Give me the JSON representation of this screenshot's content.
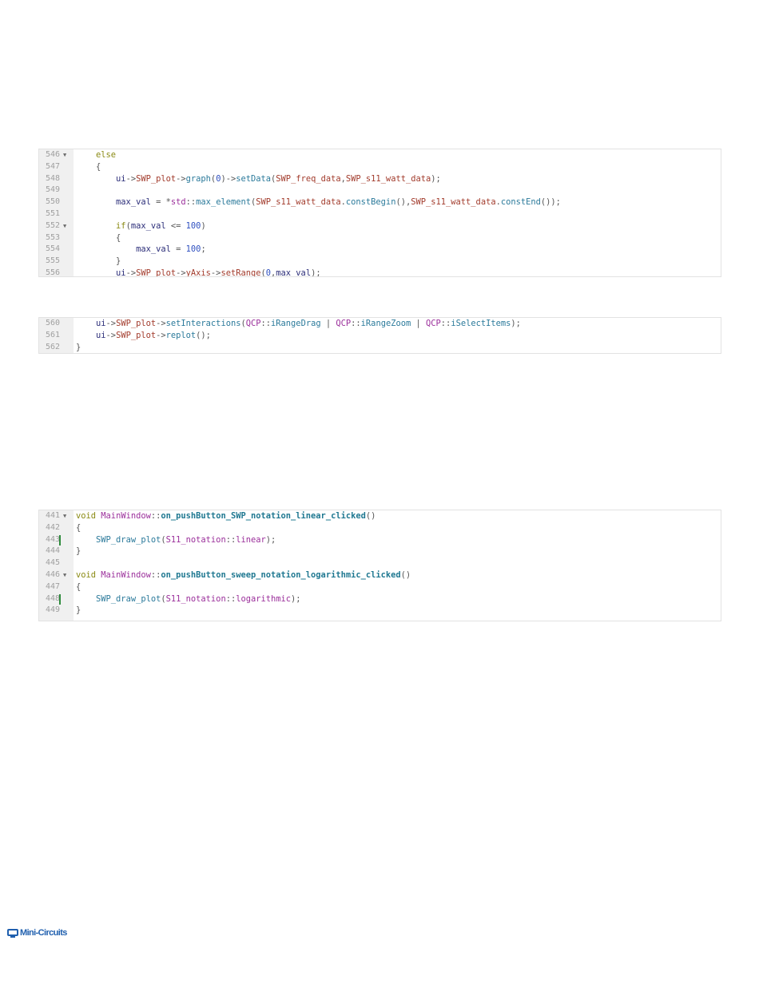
{
  "blocks": [
    {
      "lines": [
        {
          "num": "546",
          "fold": true,
          "changed": false,
          "tokens": [
            [
              "    ",
              "pun"
            ],
            [
              "else",
              "kw"
            ]
          ]
        },
        {
          "num": "547",
          "fold": false,
          "changed": false,
          "tokens": [
            [
              "    {",
              "pun"
            ]
          ]
        },
        {
          "num": "548",
          "fold": false,
          "changed": false,
          "tokens": [
            [
              "        ",
              "pun"
            ],
            [
              "ui",
              "var"
            ],
            [
              "->",
              "pun"
            ],
            [
              "SWP_plot",
              "mem"
            ],
            [
              "->",
              "pun"
            ],
            [
              "graph",
              "fn"
            ],
            [
              "(",
              "pun"
            ],
            [
              "0",
              "num"
            ],
            [
              ")->",
              "pun"
            ],
            [
              "setData",
              "fn"
            ],
            [
              "(",
              "pun"
            ],
            [
              "SWP_freq_data",
              "mem"
            ],
            [
              ",",
              "pun"
            ],
            [
              "SWP_s11_watt_data",
              "mem"
            ],
            [
              ");",
              "pun"
            ]
          ]
        },
        {
          "num": "549",
          "fold": false,
          "changed": false,
          "tokens": []
        },
        {
          "num": "550",
          "fold": false,
          "changed": false,
          "tokens": [
            [
              "        ",
              "pun"
            ],
            [
              "max_val",
              "var"
            ],
            [
              " = *",
              "pun"
            ],
            [
              "std",
              "ns"
            ],
            [
              "::",
              "pun"
            ],
            [
              "max_element",
              "fn"
            ],
            [
              "(",
              "pun"
            ],
            [
              "SWP_s11_watt_data",
              "mem"
            ],
            [
              ".",
              "pun"
            ],
            [
              "constBegin",
              "fn"
            ],
            [
              "(),",
              "pun"
            ],
            [
              "SWP_s11_watt_data",
              "mem"
            ],
            [
              ".",
              "pun"
            ],
            [
              "constEnd",
              "fn"
            ],
            [
              "());",
              "pun"
            ]
          ]
        },
        {
          "num": "551",
          "fold": false,
          "changed": false,
          "tokens": []
        },
        {
          "num": "552",
          "fold": true,
          "changed": false,
          "tokens": [
            [
              "        ",
              "pun"
            ],
            [
              "if",
              "kw"
            ],
            [
              "(",
              "pun"
            ],
            [
              "max_val",
              "var"
            ],
            [
              " <= ",
              "pun"
            ],
            [
              "100",
              "num"
            ],
            [
              ")",
              "pun"
            ]
          ]
        },
        {
          "num": "553",
          "fold": false,
          "changed": false,
          "tokens": [
            [
              "        {",
              "pun"
            ]
          ]
        },
        {
          "num": "554",
          "fold": false,
          "changed": false,
          "tokens": [
            [
              "            ",
              "pun"
            ],
            [
              "max_val",
              "var"
            ],
            [
              " = ",
              "pun"
            ],
            [
              "100",
              "num"
            ],
            [
              ";",
              "pun"
            ]
          ]
        },
        {
          "num": "555",
          "fold": false,
          "changed": false,
          "tokens": [
            [
              "        }",
              "pun"
            ]
          ]
        },
        {
          "num": "556",
          "fold": false,
          "changed": false,
          "tokens": [
            [
              "        ",
              "pun"
            ],
            [
              "ui",
              "var"
            ],
            [
              "->",
              "pun"
            ],
            [
              "SWP_plot",
              "mem"
            ],
            [
              "->",
              "pun"
            ],
            [
              "yAxis",
              "mem"
            ],
            [
              "->",
              "pun"
            ],
            [
              "setRange",
              "mem"
            ],
            [
              "(",
              "pun"
            ],
            [
              "0",
              "num"
            ],
            [
              ",",
              "pun"
            ],
            [
              "max_val",
              "var"
            ],
            [
              ");",
              "pun"
            ]
          ]
        }
      ]
    },
    {
      "lines": [
        {
          "num": "560",
          "fold": false,
          "changed": false,
          "tokens": [
            [
              "    ",
              "pun"
            ],
            [
              "ui",
              "var"
            ],
            [
              "->",
              "pun"
            ],
            [
              "SWP_plot",
              "mem"
            ],
            [
              "->",
              "pun"
            ],
            [
              "setInteractions",
              "fn"
            ],
            [
              "(",
              "pun"
            ],
            [
              "QCP",
              "ns"
            ],
            [
              "::",
              "pun"
            ],
            [
              "iRangeDrag",
              "fn"
            ],
            [
              " | ",
              "pun"
            ],
            [
              "QCP",
              "ns"
            ],
            [
              "::",
              "pun"
            ],
            [
              "iRangeZoom",
              "fn"
            ],
            [
              " | ",
              "pun"
            ],
            [
              "QCP",
              "ns"
            ],
            [
              "::",
              "pun"
            ],
            [
              "iSelectItems",
              "fn"
            ],
            [
              ");",
              "pun"
            ]
          ]
        },
        {
          "num": "561",
          "fold": false,
          "changed": false,
          "tokens": [
            [
              "    ",
              "pun"
            ],
            [
              "ui",
              "var"
            ],
            [
              "->",
              "pun"
            ],
            [
              "SWP_plot",
              "mem"
            ],
            [
              "->",
              "pun"
            ],
            [
              "replot",
              "fn"
            ],
            [
              "();",
              "pun"
            ]
          ]
        },
        {
          "num": "562",
          "fold": false,
          "changed": false,
          "tokens": [
            [
              "}",
              "pun"
            ]
          ]
        }
      ]
    },
    {
      "lines": [
        {
          "num": "441",
          "fold": true,
          "changed": false,
          "tokens": [
            [
              "void",
              "kw"
            ],
            [
              " ",
              "pun"
            ],
            [
              "MainWindow",
              "cls"
            ],
            [
              "::",
              "pun"
            ],
            [
              "on_pushButton_SWP_notation_linear_clicked",
              "def"
            ],
            [
              "()",
              "pun"
            ]
          ]
        },
        {
          "num": "442",
          "fold": false,
          "changed": false,
          "tokens": [
            [
              "{",
              "pun"
            ]
          ]
        },
        {
          "num": "443",
          "fold": false,
          "changed": true,
          "tokens": [
            [
              "    ",
              "pun"
            ],
            [
              "SWP_draw_plot",
              "fn"
            ],
            [
              "(",
              "pun"
            ],
            [
              "S11_notation",
              "ns"
            ],
            [
              "::",
              "pun"
            ],
            [
              "linear",
              "ns"
            ],
            [
              ");",
              "pun"
            ]
          ]
        },
        {
          "num": "444",
          "fold": false,
          "changed": false,
          "tokens": [
            [
              "}",
              "pun"
            ]
          ]
        },
        {
          "num": "445",
          "fold": false,
          "changed": false,
          "tokens": []
        },
        {
          "num": "446",
          "fold": true,
          "changed": false,
          "tokens": [
            [
              "void",
              "kw"
            ],
            [
              " ",
              "pun"
            ],
            [
              "MainWindow",
              "cls"
            ],
            [
              "::",
              "pun"
            ],
            [
              "on_pushButton_sweep_notation_logarithmic_clicked",
              "def"
            ],
            [
              "()",
              "pun"
            ]
          ]
        },
        {
          "num": "447",
          "fold": false,
          "changed": false,
          "tokens": [
            [
              "{",
              "pun"
            ]
          ]
        },
        {
          "num": "448",
          "fold": false,
          "changed": true,
          "tokens": [
            [
              "    ",
              "pun"
            ],
            [
              "SWP_draw_plot",
              "fn"
            ],
            [
              "(",
              "pun"
            ],
            [
              "S11_notation",
              "ns"
            ],
            [
              "::",
              "pun"
            ],
            [
              "logarithmic",
              "ns"
            ],
            [
              ");",
              "pun"
            ]
          ]
        },
        {
          "num": "449",
          "fold": false,
          "changed": false,
          "tokens": [
            [
              "}",
              "pun"
            ]
          ]
        }
      ]
    }
  ],
  "footer": {
    "logo_text": "Mini-Circuits",
    "logo_color": "#1f5fae"
  },
  "colors": {
    "gutter_bg": "#f0f0f0",
    "changed_marker": "#2e8b3c",
    "keyword": "#8a8a13",
    "function": "#2b7a9b"
  }
}
